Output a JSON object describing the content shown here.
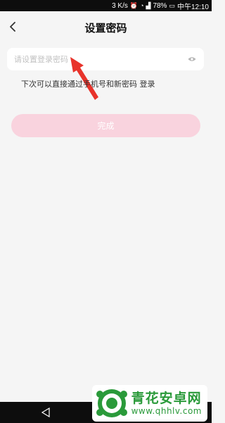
{
  "status_bar": {
    "network_speed": "3 K/s",
    "battery": "78%",
    "time": "中午12:10"
  },
  "header": {
    "title": "设置密码",
    "back_icon": "chevron-left-icon"
  },
  "password": {
    "placeholder": "请设置登录密码",
    "value": "",
    "toggle_icon": "eye-icon"
  },
  "hint_text": "下次可以直接通过手机号和新密码 登录",
  "done_button": {
    "label": "完成",
    "color": "#f9d3de"
  },
  "watermark": {
    "name": "青花安卓网",
    "url": "www.qhhlv.com"
  },
  "colors": {
    "accent": "#f9d3de",
    "annotation_arrow": "#e8332b",
    "watermark_green": "#2a9a3a"
  }
}
